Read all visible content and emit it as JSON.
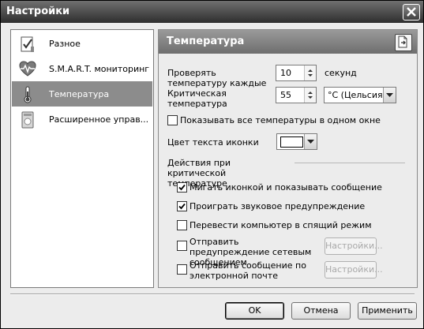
{
  "window": {
    "title": "Настройки",
    "close_icon": "close-icon"
  },
  "sidebar": {
    "items": [
      {
        "label": "Разное",
        "icon": "misc-icon",
        "selected": false
      },
      {
        "label": "S.M.A.R.T. мониторинг",
        "icon": "heart-monitor-icon",
        "selected": false
      },
      {
        "label": "Температура",
        "icon": "thermometer-icon",
        "selected": true
      },
      {
        "label": "Расширенное управ...",
        "icon": "drive-icon",
        "selected": false
      }
    ]
  },
  "panel": {
    "title": "Температура",
    "check_interval": {
      "label": "Проверять температуру каждые",
      "value": "10",
      "unit": "секунд"
    },
    "critical_temp": {
      "label": "Критическая температура",
      "value": "55",
      "unit_selected": "°C (Цельсия)"
    },
    "show_all_in_one": {
      "label": "Показывать все температуры в одном окне",
      "checked": false
    },
    "icon_text_color": {
      "label": "Цвет текста иконки",
      "value": "#ffffff"
    },
    "critical_actions": {
      "label": "Действия при критической температуре",
      "blink_icon": {
        "label": "Мигать иконкой и показывать сообщение",
        "checked": true
      },
      "play_sound": {
        "label": "Проиграть звуковое предупреждение",
        "checked": true
      },
      "sleep_mode": {
        "label": "Перевести компьютер в спящий режим",
        "checked": false
      },
      "network_message": {
        "label": "Отправить предупреждение сетевым сообщением",
        "checked": false,
        "settings_label": "Настройки..."
      },
      "email_message": {
        "label": "Отправить сообщение по электронной почте",
        "checked": false,
        "settings_label": "Настройки..."
      }
    }
  },
  "footer": {
    "ok_label": "OK",
    "cancel_label": "Отмена",
    "apply_label": "Применить"
  }
}
